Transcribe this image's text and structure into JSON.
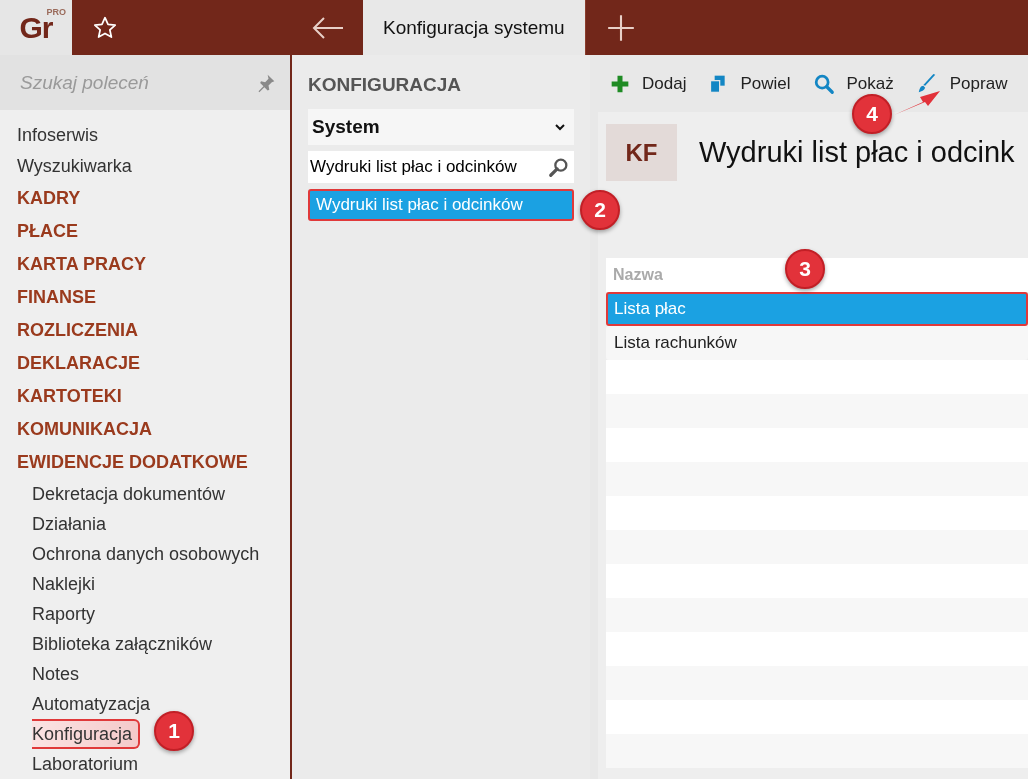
{
  "logo": {
    "text": "Gr",
    "badge": "PRO"
  },
  "tabs": [
    {
      "label": "Konfiguracja systemu",
      "selected": true
    }
  ],
  "sidebar": {
    "search": {
      "placeholder": "Szukaj poleceń"
    },
    "items": [
      {
        "label": "Infoserwis",
        "kind": "link",
        "selected": false
      },
      {
        "label": "Wyszukiwarka",
        "kind": "link",
        "selected": false
      },
      {
        "label": "KADRY",
        "kind": "section",
        "selected": false
      },
      {
        "label": "PŁACE",
        "kind": "section",
        "selected": false
      },
      {
        "label": "KARTA PRACY",
        "kind": "section",
        "selected": false
      },
      {
        "label": "FINANSE",
        "kind": "section",
        "selected": false
      },
      {
        "label": "ROZLICZENIA",
        "kind": "section",
        "selected": false
      },
      {
        "label": "DEKLARACJE",
        "kind": "section",
        "selected": false
      },
      {
        "label": "KARTOTEKI",
        "kind": "section",
        "selected": false
      },
      {
        "label": "KOMUNIKACJA",
        "kind": "section",
        "selected": false
      },
      {
        "label": "EWIDENCJE DODATKOWE",
        "kind": "section",
        "selected": false,
        "children": [
          {
            "label": "Dekretacja dokumentów",
            "selected": false
          },
          {
            "label": "Działania",
            "selected": false
          },
          {
            "label": "Ochrona danych osobowych",
            "selected": false
          },
          {
            "label": "Naklejki",
            "selected": false
          },
          {
            "label": "Raporty",
            "selected": false
          },
          {
            "label": "Biblioteka załączników",
            "selected": false
          },
          {
            "label": "Notes",
            "selected": false
          },
          {
            "label": "Automatyzacja",
            "selected": false
          },
          {
            "label": "Konfiguracja",
            "selected": true
          },
          {
            "label": "Laboratorium",
            "selected": false
          }
        ]
      }
    ]
  },
  "config": {
    "title": "KONFIGURACJA",
    "dropdown": {
      "value": "System"
    },
    "search": {
      "value": "Wydruki list płac i odcinków"
    },
    "tree": [
      {
        "label": "Wydruki list płac i odcinków",
        "selected": true
      }
    ]
  },
  "toolbar": [
    {
      "label": "Dodaj",
      "kind": "add"
    },
    {
      "label": "Powiel",
      "kind": "copy"
    },
    {
      "label": "Pokaż",
      "kind": "view"
    },
    {
      "label": "Popraw",
      "kind": "edit"
    }
  ],
  "record": {
    "badge": "KF",
    "title": "Wydruki list płac i odcink"
  },
  "table": {
    "columns": [
      "Nazwa"
    ],
    "rows": [
      {
        "name": "Lista płac",
        "selected": true
      },
      {
        "name": "Lista rachunków",
        "selected": false
      }
    ]
  },
  "annotations": [
    {
      "label": "1"
    },
    {
      "label": "2"
    },
    {
      "label": "3"
    },
    {
      "label": "4"
    }
  ]
}
